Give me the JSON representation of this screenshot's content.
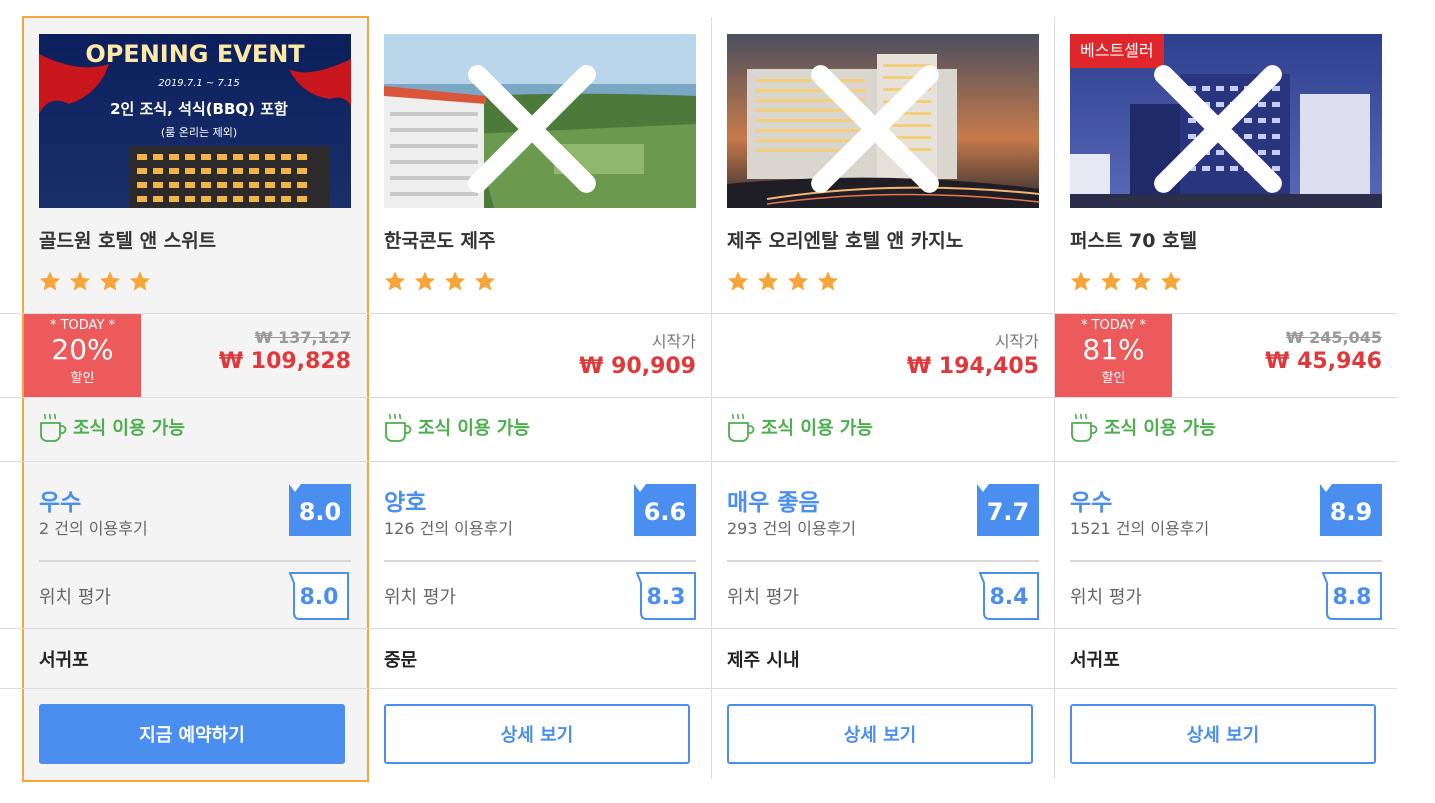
{
  "colors": {
    "accent": "#4a8ff0",
    "discount_red": "#ed5a5c",
    "price_red": "#e0383b",
    "amenity_green": "#4cae4c",
    "star": "#f6a53a",
    "selected_border": "#f6a53a",
    "best_badge": "#e0262b"
  },
  "hotels": [
    {
      "name": "골드원 호텔 앤 스위트",
      "stars": 4,
      "image_text": {
        "line1": "OPENING EVENT",
        "line2": "2019.7.1 ~ 7.15",
        "line3": "2인 조식, 석식(BBQ) 포함",
        "line4": "(룸 온리는 제외)"
      },
      "today": {
        "label": "* TODAY *",
        "percent": "20%",
        "sub": "할인"
      },
      "original_price": "₩ 137,127",
      "price": "₩ 109,828",
      "amenity": "조식 이용 가능",
      "rating_word": "우수",
      "reviews": "2 건의 이용후기",
      "score": "8.0",
      "location_label": "위치 평가",
      "location_score": "8.0",
      "area": "서귀포",
      "button": "지금 예약하기"
    },
    {
      "name": "한국콘도 제주",
      "stars": 4,
      "start_label": "시작가",
      "price": "₩ 90,909",
      "amenity": "조식 이용 가능",
      "rating_word": "양호",
      "reviews": "126 건의 이용후기",
      "score": "6.6",
      "location_label": "위치 평가",
      "location_score": "8.3",
      "area": "중문",
      "button": "상세 보기"
    },
    {
      "name": "제주 오리엔탈 호텔 앤 카지노",
      "stars": 4,
      "start_label": "시작가",
      "price": "₩ 194,405",
      "amenity": "조식 이용 가능",
      "rating_word": "매우 좋음",
      "reviews": "293 건의 이용후기",
      "score": "7.7",
      "location_label": "위치 평가",
      "location_score": "8.4",
      "area": "제주 시내",
      "button": "상세 보기"
    },
    {
      "name": "퍼스트 70 호텔",
      "stars": 4,
      "badge": "베스트셀러",
      "today": {
        "label": "* TODAY *",
        "percent": "81%",
        "sub": "할인"
      },
      "original_price": "₩ 245,045",
      "price": "₩ 45,946",
      "amenity": "조식 이용 가능",
      "rating_word": "우수",
      "reviews": "1521 건의 이용후기",
      "score": "8.9",
      "location_label": "위치 평가",
      "location_score": "8.8",
      "area": "서귀포",
      "button": "상세 보기"
    }
  ]
}
